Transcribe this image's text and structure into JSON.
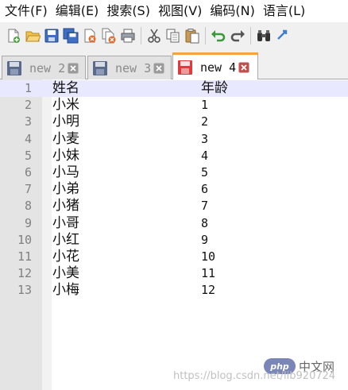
{
  "menu": [
    "文件(F)",
    "编辑(E)",
    "搜索(S)",
    "视图(V)",
    "编码(N)",
    "语言(L)"
  ],
  "toolbar": {
    "icons": [
      "new-file-icon",
      "open-file-icon",
      "save-icon",
      "save-all-icon",
      "close-icon",
      "close-all-icon",
      "print-icon",
      "cut-icon",
      "copy-icon",
      "paste-icon",
      "undo-icon",
      "redo-icon",
      "find-icon",
      "replace-icon"
    ]
  },
  "tabs": [
    {
      "label": "new 2",
      "active": false
    },
    {
      "label": "new 3",
      "active": false
    },
    {
      "label": "new 4",
      "active": true
    }
  ],
  "editor": {
    "lines": [
      {
        "num": "1",
        "name": "姓名",
        "age": "年龄"
      },
      {
        "num": "2",
        "name": "小米",
        "age": "1"
      },
      {
        "num": "3",
        "name": "小明",
        "age": "2"
      },
      {
        "num": "4",
        "name": "小麦",
        "age": "3"
      },
      {
        "num": "5",
        "name": "小妹",
        "age": "4"
      },
      {
        "num": "6",
        "name": "小马",
        "age": "5"
      },
      {
        "num": "7",
        "name": "小弟",
        "age": "6"
      },
      {
        "num": "8",
        "name": "小猪",
        "age": "7"
      },
      {
        "num": "9",
        "name": "小哥",
        "age": "8"
      },
      {
        "num": "10",
        "name": "小红",
        "age": "9"
      },
      {
        "num": "11",
        "name": "小花",
        "age": "10"
      },
      {
        "num": "12",
        "name": "小美",
        "age": "11"
      },
      {
        "num": "13",
        "name": "小梅",
        "age": "12"
      }
    ]
  },
  "watermark": {
    "badge": "php",
    "badge_text": "中文网",
    "url": "https://blog.csdn.net/lib920724"
  },
  "colors": {
    "active_tab_accent": "#f5a33c",
    "current_line": "#e8e8ff",
    "gutter": "#e4e4e4",
    "tab_close": "#c0504d"
  }
}
